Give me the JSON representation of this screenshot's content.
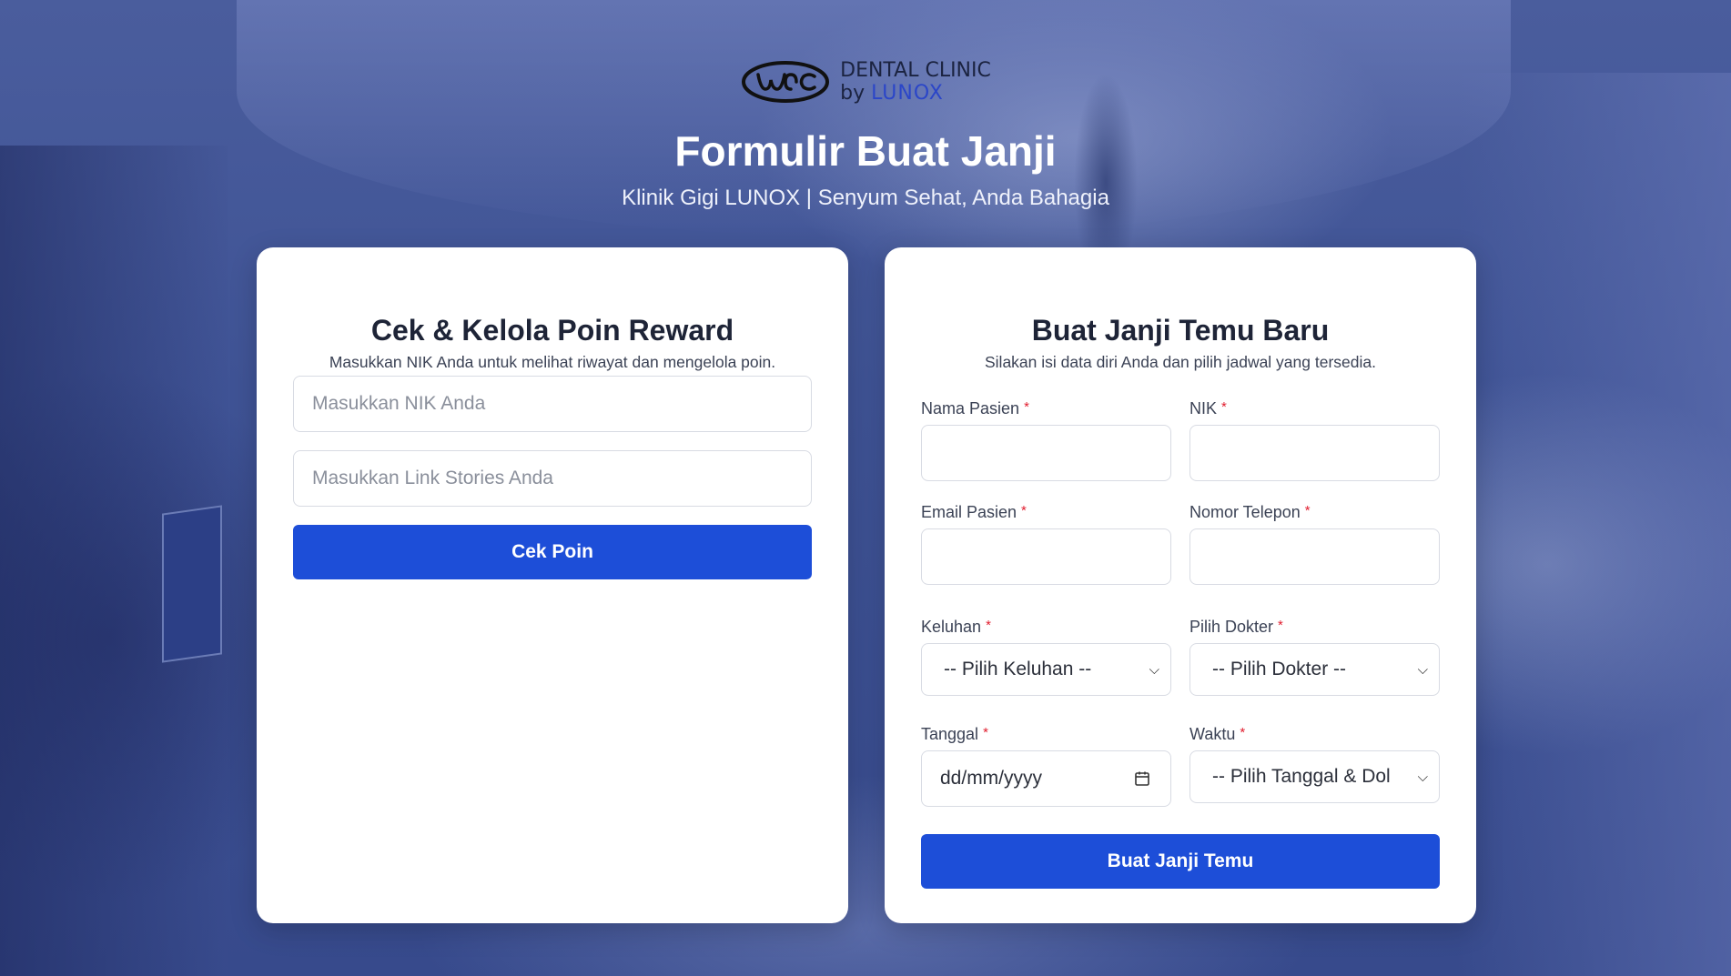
{
  "header": {
    "logo_line1": "DENTAL CLINIC",
    "logo_by": "by",
    "logo_brand": "LUNOX",
    "title": "Formulir Buat Janji",
    "subtitle": "Klinik Gigi LUNOX | Senyum Sehat, Anda Bahagia"
  },
  "reward": {
    "title": "Cek & Kelola Poin Reward",
    "description": "Masukkan NIK Anda untuk melihat riwayat dan mengelola poin.",
    "nik_placeholder": "Masukkan NIK Anda",
    "stories_placeholder": "Masukkan Link Stories Anda",
    "button_label": "Cek Poin"
  },
  "appointment": {
    "title": "Buat Janji Temu Baru",
    "description": "Silakan isi data diri Anda dan pilih jadwal yang tersedia.",
    "required_mark": "*",
    "nama_label": "Nama Pasien",
    "nik_label": "NIK",
    "email_label": "Email Pasien",
    "telepon_label": "Nomor Telepon",
    "keluhan_label": "Keluhan",
    "keluhan_value": "-- Pilih Keluhan --",
    "dokter_label": "Pilih Dokter",
    "dokter_value": "-- Pilih Dokter --",
    "tanggal_label": "Tanggal",
    "tanggal_placeholder": "dd/mm/yyyy",
    "waktu_label": "Waktu",
    "waktu_value": "-- Pilih Tanggal & Dol",
    "button_label": "Buat Janji Temu"
  },
  "colors": {
    "primary": "#1d4ed8",
    "required": "#e11d2e",
    "background_tint": "#3e5294"
  }
}
